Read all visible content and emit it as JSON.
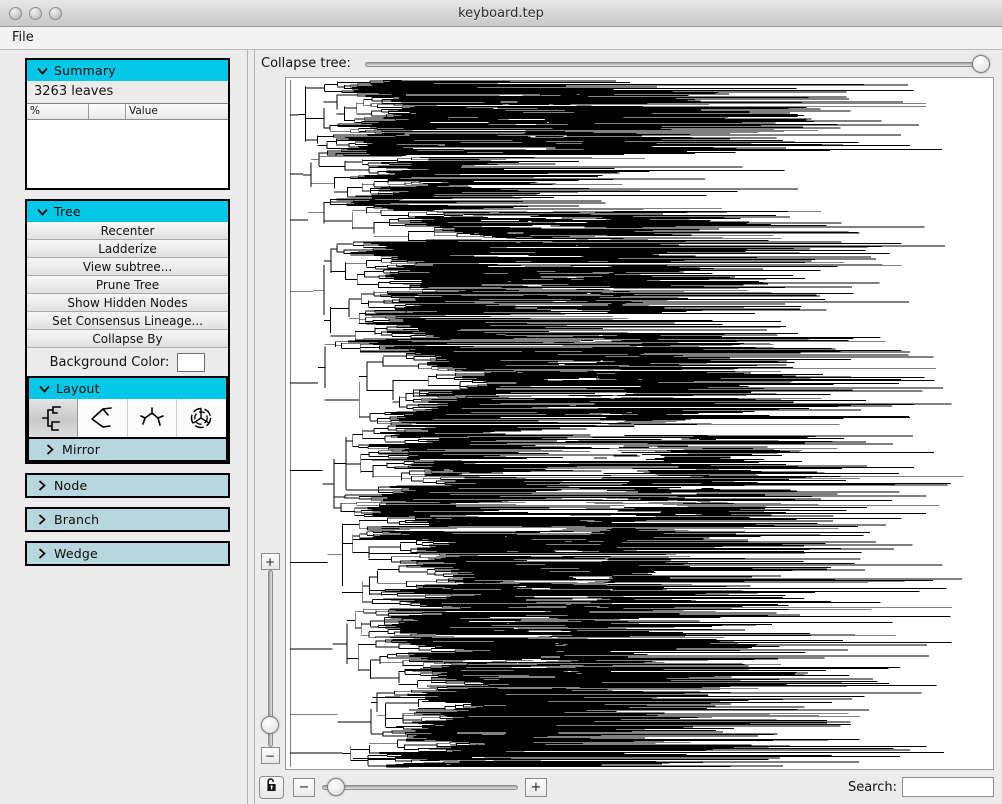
{
  "window": {
    "title": "keyboard.tep",
    "traffic_lights": [
      "close-button",
      "minimize-button",
      "zoom-button"
    ]
  },
  "menubar": {
    "items": [
      {
        "label": "File"
      }
    ]
  },
  "sidebar": {
    "summary": {
      "title": "Summary",
      "twisty": "twisty-open",
      "leaf_count_text": "3263 leaves",
      "table": {
        "columns": [
          "%",
          "",
          "Value"
        ],
        "rows": []
      }
    },
    "tree": {
      "title": "Tree",
      "twisty": "twisty-open",
      "buttons": [
        {
          "label": "Recenter"
        },
        {
          "label": "Ladderize"
        },
        {
          "label": "View subtree..."
        },
        {
          "label": "Prune Tree"
        },
        {
          "label": "Show Hidden Nodes"
        },
        {
          "label": "Set Consensus Lineage..."
        },
        {
          "label": "Collapse By"
        }
      ],
      "background_color": {
        "label": "Background Color:",
        "value": "#ffffff"
      },
      "layout": {
        "title": "Layout",
        "twisty": "twisty-open",
        "options": [
          {
            "name": "rectangular-layout-icon",
            "selected": true
          },
          {
            "name": "slanted-layout-icon",
            "selected": false
          },
          {
            "name": "unrooted-layout-icon",
            "selected": false
          },
          {
            "name": "circular-layout-icon",
            "selected": false
          }
        ],
        "mirror": {
          "label": "Mirror",
          "twisty": "twisty-closed"
        }
      }
    },
    "collapsed_panels": [
      {
        "label": "Node",
        "twisty": "twisty-closed"
      },
      {
        "label": "Branch",
        "twisty": "twisty-closed"
      },
      {
        "label": "Wedge",
        "twisty": "twisty-closed"
      }
    ]
  },
  "toolbar": {
    "collapse_tree": {
      "label": "Collapse tree:",
      "value": 100,
      "min": 0,
      "max": 100
    }
  },
  "tree_view": {
    "vertical_zoom": {
      "plus_label": "+",
      "minus_label": "−",
      "value": 8,
      "min": 0,
      "max": 100
    },
    "canvas_background": "#ffffff",
    "tree_line_color": "#000000",
    "leaf_count": 3263
  },
  "bottombar": {
    "lock": {
      "name": "unlock-icon",
      "state": "unlocked"
    },
    "zoom_out_label": "−",
    "zoom_in_label": "+",
    "horizontal_zoom": {
      "value": 3,
      "min": 0,
      "max": 100
    },
    "search": {
      "label": "Search:",
      "value": "",
      "placeholder": ""
    }
  },
  "colors": {
    "panel_header_active": "#00c8e6",
    "panel_header_collapsed": "#b8d6dd",
    "window_bg": "#ececec",
    "canvas_bg": "#ffffff"
  }
}
